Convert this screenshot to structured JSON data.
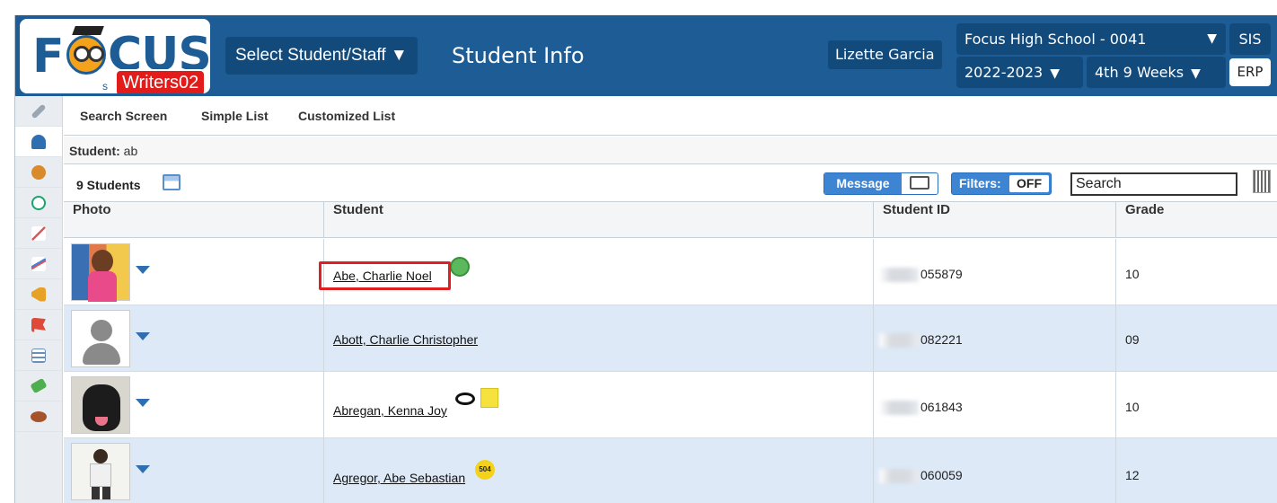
{
  "header": {
    "logo_text": "FOCUS",
    "logo_sub": "s",
    "badge": "Writers02",
    "select_label": "Select Student/Staff ▼",
    "page_title": "Student Info",
    "user_name": "Lizette Garcia",
    "school": "Focus High School - 0041",
    "year": "2022-2023",
    "term": "4th 9 Weeks",
    "arrow": "▼",
    "sis_label": "SIS",
    "erp_label": "ERP"
  },
  "sidebar": {
    "items": [
      {
        "icon": "wrench-icon",
        "color": "#8a96a2"
      },
      {
        "icon": "student-icon",
        "color": "#2f6eb0"
      },
      {
        "icon": "users-icon",
        "color": "#d98a2b"
      },
      {
        "icon": "clock-icon",
        "color": "#1aa36b"
      },
      {
        "icon": "grades-chart-icon",
        "color": "#e25555"
      },
      {
        "icon": "trend-chart-icon",
        "color": "#4a7fd1"
      },
      {
        "icon": "megaphone-icon",
        "color": "#e6a126"
      },
      {
        "icon": "flag-icon",
        "color": "#e0483a"
      },
      {
        "icon": "form-icon",
        "color": "#6a8fb8"
      },
      {
        "icon": "money-icon",
        "color": "#4fae4f"
      },
      {
        "icon": "football-icon",
        "color": "#a5532b"
      }
    ]
  },
  "subnav": {
    "links": [
      "Search Screen",
      "Simple List",
      "Customized List"
    ]
  },
  "breadcrumb": {
    "label": "Student:",
    "value": "ab"
  },
  "toolbar": {
    "count": "9 Students",
    "message_label": "Message",
    "filters_label": "Filters:",
    "filters_value": "OFF",
    "search_value": "Search"
  },
  "table": {
    "columns": [
      "Photo",
      "Student",
      "Student ID",
      "Grade"
    ],
    "rows": [
      {
        "name": "Abe, Charlie Noel",
        "id": "055879",
        "grade": "10",
        "photo": "photo-girl-books",
        "badge": "green-person-icon"
      },
      {
        "name": "Abott, Charlie Christopher",
        "id": "082221",
        "grade": "09",
        "photo": "photo-placeholder",
        "badge": ""
      },
      {
        "name": "Abregan, Kenna Joy",
        "id": "061843",
        "grade": "10",
        "photo": "photo-dog",
        "badge": "eye-and-note-icons"
      },
      {
        "name": "Agregor, Abe Sebastian",
        "id": "060059",
        "grade": "12",
        "photo": "photo-boy",
        "badge": "504"
      }
    ]
  }
}
